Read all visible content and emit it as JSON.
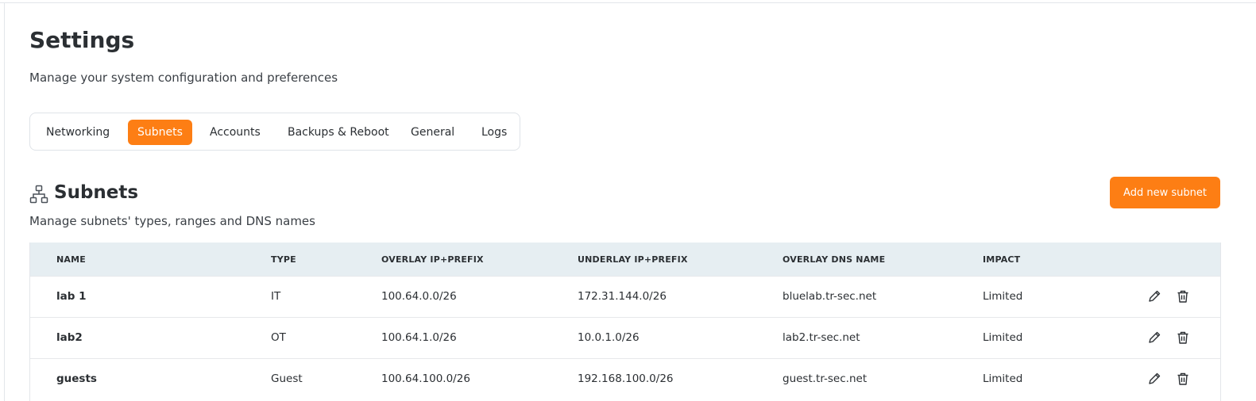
{
  "page": {
    "title": "Settings",
    "subtitle": "Manage your system configuration and preferences"
  },
  "tabs": [
    {
      "label": "Networking",
      "active": false
    },
    {
      "label": "Subnets",
      "active": true
    },
    {
      "label": "Accounts",
      "active": false
    },
    {
      "label": "Backups & Reboot",
      "active": false
    },
    {
      "label": "General",
      "active": false
    },
    {
      "label": "Logs",
      "active": false
    }
  ],
  "section": {
    "icon": "network-hierarchy-icon",
    "title": "Subnets",
    "subtitle": "Manage subnets' types, ranges and DNS names",
    "add_button": "Add new subnet"
  },
  "table": {
    "columns": [
      "NAME",
      "TYPE",
      "OVERLAY IP+PREFIX",
      "UNDERLAY IP+PREFIX",
      "OVERLAY DNS NAME",
      "IMPACT"
    ],
    "rows": [
      {
        "name": "lab 1",
        "type": "IT",
        "overlay": "100.64.0.0/26",
        "underlay": "172.31.144.0/26",
        "dns": "bluelab.tr-sec.net",
        "impact": "Limited"
      },
      {
        "name": "lab2",
        "type": "OT",
        "overlay": "100.64.1.0/26",
        "underlay": "10.0.1.0/26",
        "dns": "lab2.tr-sec.net",
        "impact": "Limited"
      },
      {
        "name": "guests",
        "type": "Guest",
        "overlay": "100.64.100.0/26",
        "underlay": "192.168.100.0/26",
        "dns": "guest.tr-sec.net",
        "impact": "Limited"
      }
    ],
    "row_actions": [
      "pencil-icon",
      "trash-icon"
    ]
  },
  "colors": {
    "accent": "#fd7e14",
    "table_header_bg": "#e6eef2",
    "text": "#2b2f33"
  }
}
